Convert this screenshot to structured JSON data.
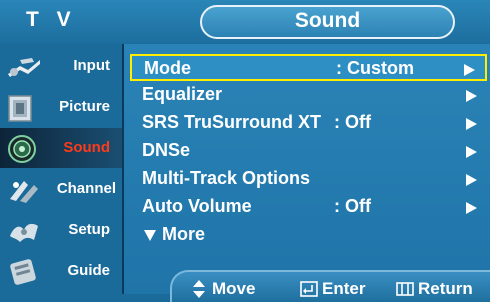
{
  "header": {
    "left_title": "T V",
    "menu_title": "Sound"
  },
  "sidebar": {
    "items": [
      {
        "label": "Input",
        "icon": "input-icon",
        "active": false
      },
      {
        "label": "Picture",
        "icon": "picture-icon",
        "active": false
      },
      {
        "label": "Sound",
        "icon": "sound-icon",
        "active": true
      },
      {
        "label": "Channel",
        "icon": "channel-icon",
        "active": false
      },
      {
        "label": "Setup",
        "icon": "setup-icon",
        "active": false
      },
      {
        "label": "Guide",
        "icon": "guide-icon",
        "active": false
      }
    ]
  },
  "menu": {
    "items": [
      {
        "name": "Mode",
        "value": ": Custom",
        "has_arrow": true,
        "selected": true
      },
      {
        "name": "Equalizer",
        "value": "",
        "has_arrow": true,
        "selected": false
      },
      {
        "name": "SRS TruSurround XT",
        "value": ": Off",
        "has_arrow": true,
        "selected": false
      },
      {
        "name": "DNSe",
        "value": "",
        "has_arrow": true,
        "selected": false
      },
      {
        "name": "Multi-Track Options",
        "value": "",
        "has_arrow": true,
        "selected": false
      },
      {
        "name": "Auto Volume",
        "value": ": Off",
        "has_arrow": true,
        "selected": false
      }
    ],
    "more_label": "More"
  },
  "footer": {
    "move_label": "Move",
    "enter_label": "Enter",
    "return_label": "Return"
  },
  "colors": {
    "selection_border": "#ffee00",
    "active_sidebar_text": "#ff3a1a",
    "panel_blue": "#2a83b6"
  }
}
